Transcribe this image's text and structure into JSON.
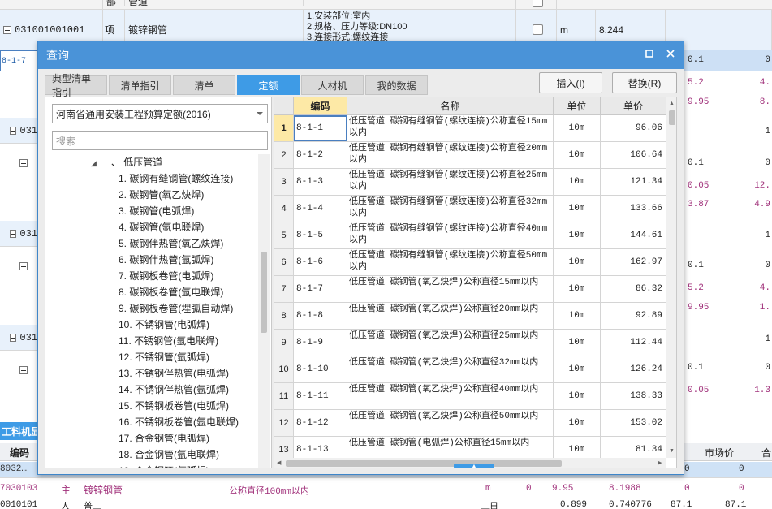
{
  "background": {
    "header": {
      "col_dept": "部",
      "col_name": "管道"
    },
    "main_row": {
      "code": "031001001001",
      "type": "项",
      "name": "镀锌钢管",
      "desc": [
        "1.安装部位:室内",
        "2.规格、压力等级:DN100",
        "3.连接形式:螺纹连接"
      ],
      "unit": "m",
      "qty": "8.244"
    },
    "partial_code": "8-1-7",
    "partial_codes": [
      "031",
      "031",
      "031"
    ],
    "right_values": [
      {
        "a": "0.1",
        "b": "0"
      },
      {
        "a": "5.2",
        "b": "4."
      },
      {
        "a": "9.95",
        "b": "8."
      },
      {
        "a": "",
        "b": "1"
      },
      {
        "a": "0.1",
        "b": "0"
      },
      {
        "a": "0.05",
        "b": "12."
      },
      {
        "a": "3.87",
        "b": "4.9"
      },
      {
        "a": "",
        "b": "1"
      },
      {
        "a": "0.1",
        "b": "0"
      },
      {
        "a": "5.2",
        "b": "4."
      },
      {
        "a": "9.95",
        "b": "1."
      },
      {
        "a": "",
        "b": "1"
      },
      {
        "a": "0.1",
        "b": "0"
      },
      {
        "a": "0.05",
        "b": "1.3"
      }
    ],
    "bottom_panel_label": "工料机显示",
    "bottom_header": {
      "code": "编码",
      "market": "市场价",
      "combined": "合"
    },
    "bottom_rows": [
      {
        "code": "8032…",
        "v1": "0",
        "v2": "0"
      },
      {
        "code": "7030103",
        "type": "主",
        "name": "镀锌钢管",
        "spec": "公称直径100mm以内",
        "unit": "m",
        "qty0": "0",
        "qty": "9.95",
        "price": "8.1988",
        "v1": "0",
        "v2": "0"
      },
      {
        "code": "0010101",
        "type": "人",
        "name": "普工",
        "unit": "工日",
        "qty": "0.899",
        "price": "0.740776",
        "v1": "87.1",
        "v2": "87.1"
      }
    ]
  },
  "dialog": {
    "title": "查询",
    "tabs": [
      "典型清单指引",
      "清单指引",
      "清单",
      "定额",
      "人材机",
      "我的数据"
    ],
    "active_tab": 3,
    "insert_button": "插入(I)",
    "replace_button": "替换(R)",
    "quota_library": "河南省通用安装工程预算定额(2016)",
    "search_placeholder": "搜索",
    "tree_parent": "一、 低压管道",
    "tree_items": [
      "1. 碳钢有缝钢管(螺纹连接)",
      "2. 碳钢管(氧乙炔焊)",
      "3. 碳钢管(电弧焊)",
      "4. 碳钢管(氩电联焊)",
      "5. 碳钢伴热管(氧乙炔焊)",
      "6. 碳钢伴热管(氩弧焊)",
      "7. 碳钢板卷管(电弧焊)",
      "8. 碳钢板卷管(氩电联焊)",
      "9. 碳钢板卷管(埋弧自动焊)",
      "10. 不锈钢管(电弧焊)",
      "11. 不锈钢管(氩电联焊)",
      "12. 不锈钢管(氩弧焊)",
      "13. 不锈钢伴热管(电弧焊)",
      "14. 不锈钢伴热管(氩弧焊)",
      "15. 不锈钢板卷管(电弧焊)",
      "16. 不锈钢板卷管(氩电联焊)",
      "17. 合金钢管(电弧焊)",
      "18. 合金钢管(氩电联焊)",
      "19. 合金钢管(氩弧焊)"
    ],
    "table_headers": {
      "code": "编码",
      "name": "名称",
      "unit": "单位",
      "price": "单价"
    },
    "rows": [
      {
        "no": "1",
        "code": "8-1-1",
        "name": "低压管道 碳钢有缝钢管(螺纹连接)公称直径15mm以内",
        "unit": "10m",
        "price": "96.06"
      },
      {
        "no": "2",
        "code": "8-1-2",
        "name": "低压管道 碳钢有缝钢管(螺纹连接)公称直径20mm以内",
        "unit": "10m",
        "price": "106.64"
      },
      {
        "no": "3",
        "code": "8-1-3",
        "name": "低压管道 碳钢有缝钢管(螺纹连接)公称直径25mm以内",
        "unit": "10m",
        "price": "121.34"
      },
      {
        "no": "4",
        "code": "8-1-4",
        "name": "低压管道 碳钢有缝钢管(螺纹连接)公称直径32mm以内",
        "unit": "10m",
        "price": "133.66"
      },
      {
        "no": "5",
        "code": "8-1-5",
        "name": "低压管道 碳钢有缝钢管(螺纹连接)公称直径40mm以内",
        "unit": "10m",
        "price": "144.61"
      },
      {
        "no": "6",
        "code": "8-1-6",
        "name": "低压管道 碳钢有缝钢管(螺纹连接)公称直径50mm以内",
        "unit": "10m",
        "price": "162.97"
      },
      {
        "no": "7",
        "code": "8-1-7",
        "name": "低压管道 碳钢管(氧乙炔焊)公称直径15mm以内",
        "unit": "10m",
        "price": "86.32"
      },
      {
        "no": "8",
        "code": "8-1-8",
        "name": "低压管道 碳钢管(氧乙炔焊)公称直径20mm以内",
        "unit": "10m",
        "price": "92.89"
      },
      {
        "no": "9",
        "code": "8-1-9",
        "name": "低压管道 碳钢管(氧乙炔焊)公称直径25mm以内",
        "unit": "10m",
        "price": "112.44"
      },
      {
        "no": "10",
        "code": "8-1-10",
        "name": "低压管道 碳钢管(氧乙炔焊)公称直径32mm以内",
        "unit": "10m",
        "price": "126.24"
      },
      {
        "no": "11",
        "code": "8-1-11",
        "name": "低压管道 碳钢管(氧乙炔焊)公称直径40mm以内",
        "unit": "10m",
        "price": "138.33"
      },
      {
        "no": "12",
        "code": "8-1-12",
        "name": "低压管道 碳钢管(氧乙炔焊)公称直径50mm以内",
        "unit": "10m",
        "price": "153.02"
      },
      {
        "no": "13",
        "code": "8-1-13",
        "name": "低压管道 碳钢管(电弧焊)公称直径15mm以内",
        "unit": "10m",
        "price": "81.34"
      }
    ]
  }
}
